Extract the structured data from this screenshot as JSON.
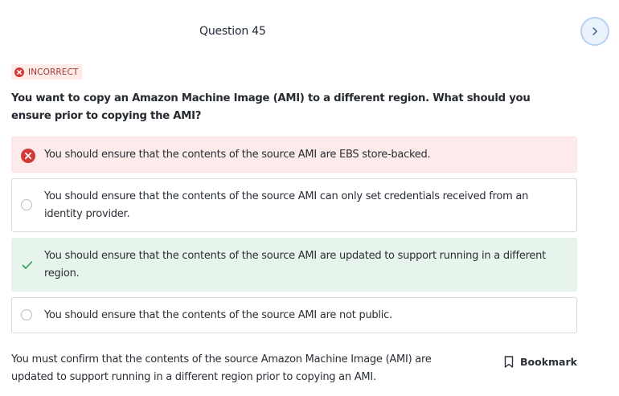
{
  "header": {
    "question_title": "Question 45"
  },
  "status": {
    "label": "INCORRECT",
    "color": "#d33a36"
  },
  "question": {
    "text": "You want to copy an Amazon Machine Image (AMI) to a different region. What should you ensure prior to copying the AMI?"
  },
  "options": [
    {
      "text": "You should ensure that the contents of the source AMI are EBS store-backed.",
      "state": "selected-incorrect",
      "icon": "x-circle-icon"
    },
    {
      "text": "You should ensure that the contents of the source AMI can only set credentials received from an identity provider.",
      "state": "unselected",
      "icon": "radio-icon"
    },
    {
      "text": "You should ensure that the contents of the source AMI are updated to support running in a different region.",
      "state": "correct",
      "icon": "check-icon"
    },
    {
      "text": "You should ensure that the contents of the source AMI are not public.",
      "state": "unselected",
      "icon": "radio-icon"
    }
  ],
  "explanation": {
    "text": "You must confirm that the contents of the source Amazon Machine Image (AMI) are updated to support running in a different region prior to copying an AMI."
  },
  "actions": {
    "bookmark_label": "Bookmark",
    "next_icon": "chevron-right-icon"
  },
  "colors": {
    "incorrect_bg": "#fdeaea",
    "correct_bg": "#e7f4ec",
    "accent": "#4a7fc1",
    "correct_mark": "#2f9e55"
  }
}
